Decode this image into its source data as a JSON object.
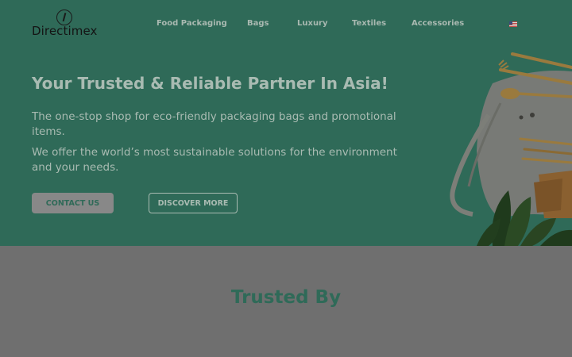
{
  "brand": {
    "name": "Directimex"
  },
  "nav": {
    "items": [
      "Food Packaging",
      "Bags",
      "Luxury",
      "Textiles",
      "Accessories"
    ],
    "language_icon": "us-flag-icon"
  },
  "hero": {
    "headline": "Your Trusted & Reliable Partner In Asia!",
    "paragraph_1": "The one-stop shop for eco-friendly packaging bags and promotional items.",
    "paragraph_2": "We offer the world’s most sustainable solutions for the environment and your needs.",
    "contact_button": "CONTACT US",
    "discover_button": "DISCOVER MORE",
    "image": "eco-tote-bag-cutlery-image"
  },
  "trusted": {
    "title": "Trusted By"
  },
  "colors": {
    "hero_bg": "#2f6a58",
    "page_bg": "#6f6f6f",
    "accent": "#2f6a58"
  }
}
